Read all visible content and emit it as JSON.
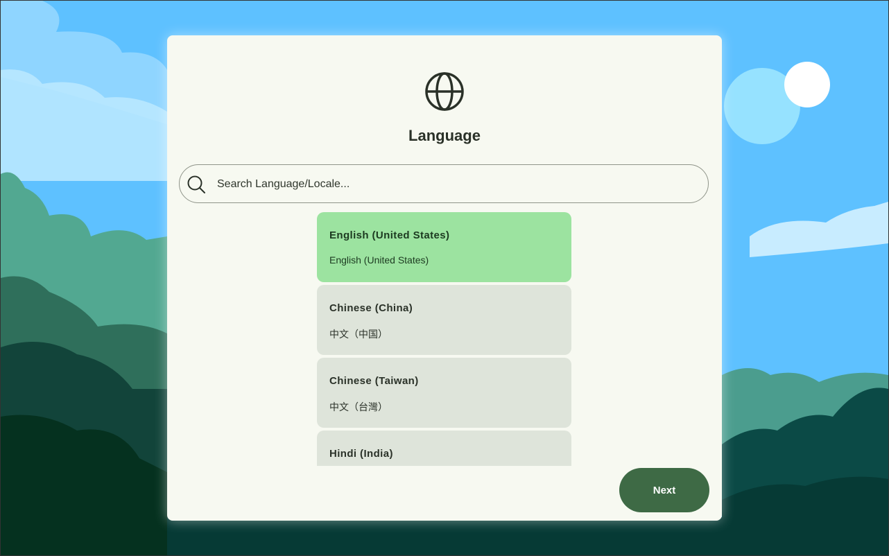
{
  "dialog": {
    "icon": "globe-icon",
    "title": "Language"
  },
  "search": {
    "icon": "search-icon",
    "placeholder": "Search Language/Locale...",
    "value": ""
  },
  "languages": [
    {
      "name": "English (United States)",
      "native": "English (United States)",
      "selected": true
    },
    {
      "name": "Chinese (China)",
      "native": "中文（中国）",
      "selected": false
    },
    {
      "name": "Chinese (Taiwan)",
      "native": "中文（台灣）",
      "selected": false
    },
    {
      "name": "Hindi (India)",
      "native": "",
      "selected": false
    }
  ],
  "footer": {
    "next_label": "Next"
  },
  "colors": {
    "accent": "#3e6a45",
    "selected": "#9ce3a0",
    "item": "#dee4da",
    "surface": "#f7f9f1",
    "sky": "#5ec1ff"
  }
}
